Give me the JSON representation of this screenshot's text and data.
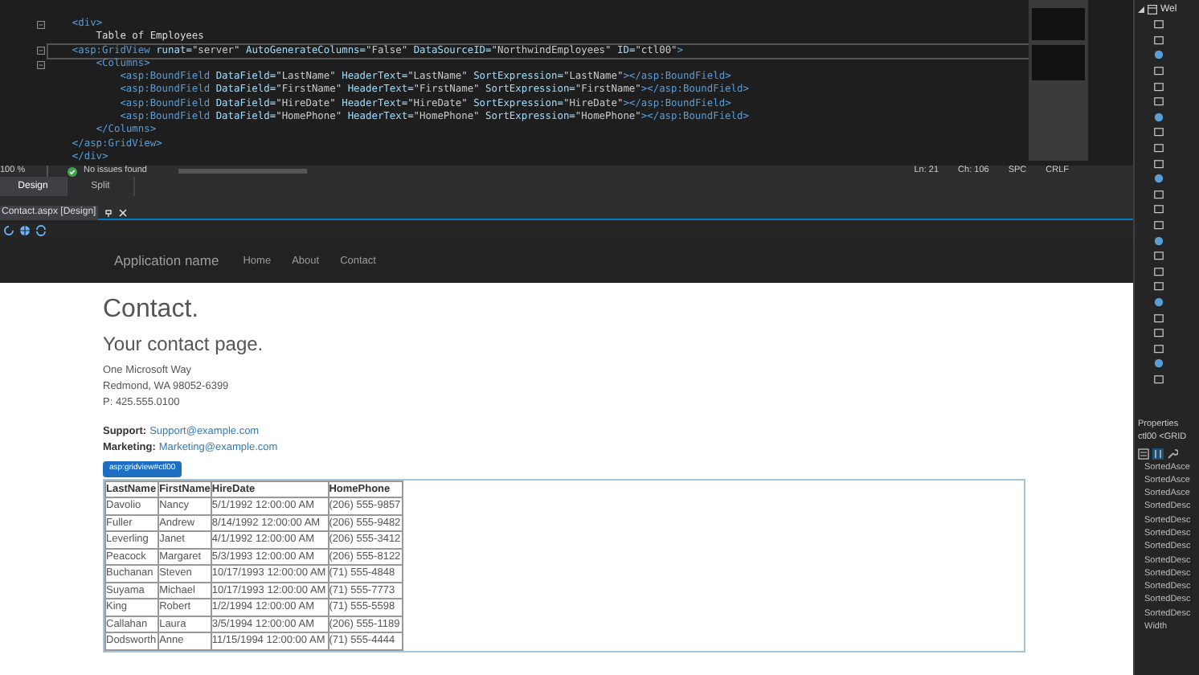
{
  "editor": {
    "lines": [
      {
        "text": "    <div>",
        "foldable": true,
        "current": false
      },
      {
        "text": "        Table of Employees",
        "foldable": false,
        "current": false
      },
      {
        "text": "    <asp:GridView runat=\"server\" AutoGenerateColumns=\"False\" DataSourceID=\"NorthwindEmployees\" ID=\"ctl00\">",
        "foldable": true,
        "current": true
      },
      {
        "text": "        <Columns>",
        "foldable": true,
        "current": false
      },
      {
        "text": "            <asp:BoundField DataField=\"LastName\" HeaderText=\"LastName\" SortExpression=\"LastName\"></asp:BoundField>",
        "foldable": false,
        "current": false
      },
      {
        "text": "            <asp:BoundField DataField=\"FirstName\" HeaderText=\"FirstName\" SortExpression=\"FirstName\"></asp:BoundField>",
        "foldable": false,
        "current": false
      },
      {
        "text": "            <asp:BoundField DataField=\"HireDate\" HeaderText=\"HireDate\" SortExpression=\"HireDate\"></asp:BoundField>",
        "foldable": false,
        "current": false
      },
      {
        "text": "            <asp:BoundField DataField=\"HomePhone\" HeaderText=\"HomePhone\" SortExpression=\"HomePhone\"></asp:BoundField>",
        "foldable": false,
        "current": false
      },
      {
        "text": "        </Columns>",
        "foldable": false,
        "current": false
      },
      {
        "text": "    </asp:GridView>",
        "foldable": false,
        "current": false
      },
      {
        "text": "    </div>",
        "foldable": false,
        "current": false
      }
    ],
    "status": {
      "zoom": "100 %",
      "issues": "No issues found",
      "line": "Ln: 21",
      "column": "Ch: 106",
      "spacing": "SPC",
      "line_ending": "CRLF"
    },
    "view_tabs": [
      {
        "label": "Design",
        "selected": true
      },
      {
        "label": "Split",
        "selected": false
      }
    ]
  },
  "document_tab": {
    "title": "Contact.aspx [Design]"
  },
  "site": {
    "brand": "Application name",
    "nav": [
      "Home",
      "About",
      "Contact"
    ],
    "heading": "Contact.",
    "subheading": "Your contact page.",
    "address": [
      "One Microsoft Way",
      "Redmond, WA 98052-6399",
      "P: 425.555.0100"
    ],
    "contacts": [
      {
        "label": "Support:",
        "email": "Support@example.com"
      },
      {
        "label": "Marketing:",
        "email": "Marketing@example.com"
      }
    ],
    "selected_control": "asp:gridview#ctl00",
    "table": {
      "columns": [
        "LastName",
        "FirstName",
        "HireDate",
        "HomePhone"
      ],
      "rows": [
        [
          "Davolio",
          "Nancy",
          "5/1/1992 12:00:00 AM",
          "(206) 555-9857"
        ],
        [
          "Fuller",
          "Andrew",
          "8/14/1992 12:00:00 AM",
          "(206) 555-9482"
        ],
        [
          "Leverling",
          "Janet",
          "4/1/1992 12:00:00 AM",
          "(206) 555-3412"
        ],
        [
          "Peacock",
          "Margaret",
          "5/3/1993 12:00:00 AM",
          "(206) 555-8122"
        ],
        [
          "Buchanan",
          "Steven",
          "10/17/1993 12:00:00 AM",
          "(71) 555-4848"
        ],
        [
          "Suyama",
          "Michael",
          "10/17/1993 12:00:00 AM",
          "(71) 555-7773"
        ],
        [
          "King",
          "Robert",
          "1/2/1994 12:00:00 AM",
          "(71) 555-5598"
        ],
        [
          "Callahan",
          "Laura",
          "3/5/1994 12:00:00 AM",
          "(206) 555-1189"
        ],
        [
          "Dodsworth",
          "Anne",
          "11/15/1994 12:00:00 AM",
          "(71) 555-4444"
        ]
      ]
    }
  },
  "solution_explorer": {
    "root": {
      "label": "Wel",
      "expanded": true
    }
  },
  "properties": {
    "title": "Properties",
    "object": "ctl00 <GRID",
    "items": [
      "SortedAsce",
      "SortedAsce",
      "SortedAsce",
      "SortedDesc",
      "SortedDesc",
      "SortedDesc",
      "SortedDesc",
      "SortedDesc",
      "SortedDesc",
      "SortedDesc",
      "SortedDesc",
      "SortedDesc",
      "Width"
    ]
  }
}
